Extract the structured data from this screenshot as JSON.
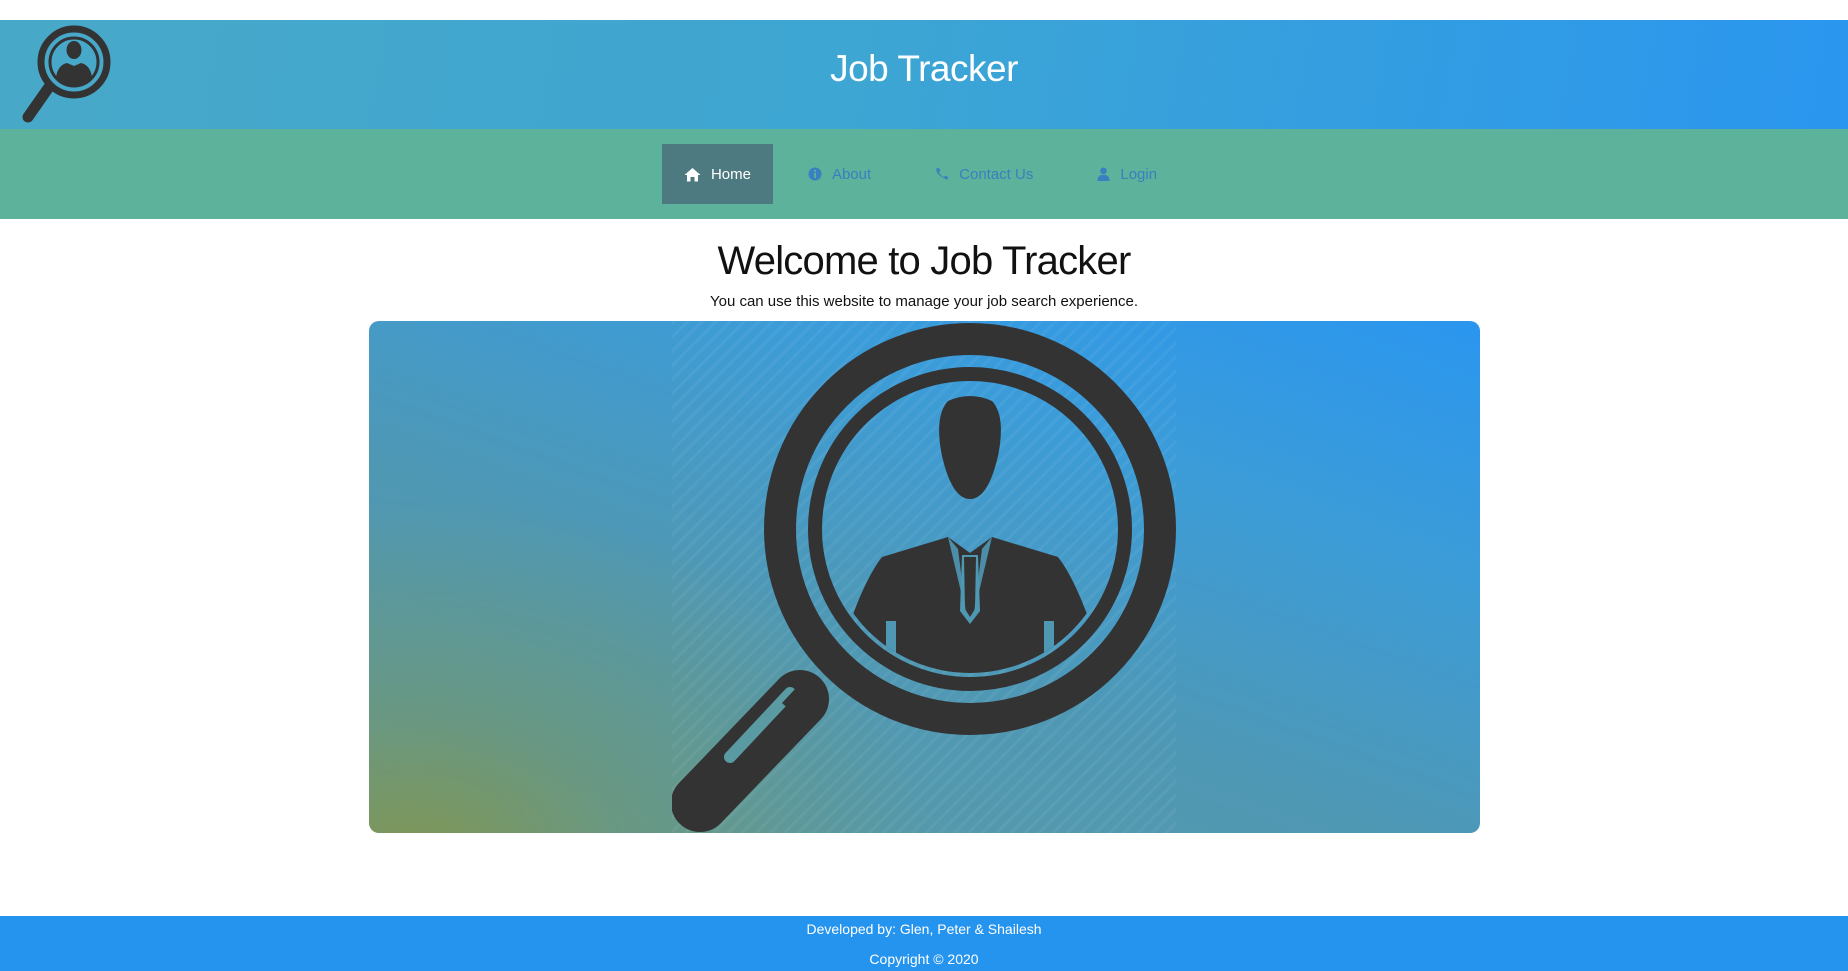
{
  "header": {
    "title": "Job Tracker",
    "logo": "magnifier-person-logo"
  },
  "nav": {
    "items": [
      {
        "label": "Home",
        "icon": "home-icon",
        "active": true
      },
      {
        "label": "About",
        "icon": "info-icon",
        "active": false
      },
      {
        "label": "Contact Us",
        "icon": "phone-icon",
        "active": false
      },
      {
        "label": "Login",
        "icon": "user-icon",
        "active": false
      }
    ]
  },
  "main": {
    "title": "Welcome to Job Tracker",
    "subtitle": "You can use this website to manage your job search experience.",
    "hero_image": "magnifier-person-illustration"
  },
  "footer": {
    "developed_by": "Developed by: Glen, Peter & Shailesh",
    "copyright": "Copyright © 2020"
  },
  "colors": {
    "banner": "#3ea6d2",
    "navbar": "#5cb29b",
    "nav_active": "#4d7a80",
    "nav_link": "#3a7fc0",
    "footer": "#2594ef",
    "icon_dark": "#333333"
  }
}
